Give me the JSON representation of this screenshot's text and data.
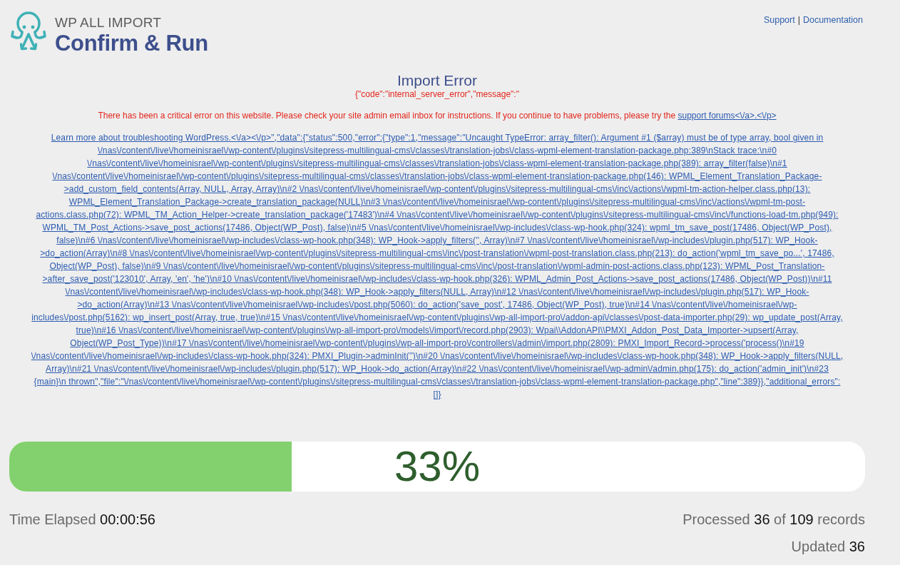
{
  "header": {
    "brand": "WP ALL IMPORT",
    "title": "Confirm & Run",
    "links": [
      {
        "label": "Support"
      },
      {
        "label": "Documentation"
      }
    ],
    "separator": "|"
  },
  "error": {
    "title": "Import Error",
    "code_line": "{\"code\":\"internal_server_error\",\"message\":\"",
    "message": {
      "text": "There has been a critical error on this website. Please check your site admin email inbox for instructions. If you continue to have problems, please try the",
      "link": "support forums<\\/a>.<\\/p>"
    },
    "details_link": "Learn more about troubleshooting WordPress.<\\/a><\\/p>\",\"data\":{\"status\":500,\"error\":{\"type\":1,\"message\":\"Uncaught TypeError: array_filter(): Argument #1 ($array) must be of type array, bool given in \\/nas\\/content\\/live\\/homeinisrael\\/wp-content\\/plugins\\/sitepress-multilingual-cms\\/classes\\/translation-jobs\\/class-wpml-element-translation-package.php:389\\nStack trace:\\n#0 \\/nas\\/content\\/live\\/homeinisrael\\/wp-content\\/plugins\\/sitepress-multilingual-cms\\/classes\\/translation-jobs\\/class-wpml-element-translation-package.php(389): array_filter(false)\\n#1 \\/nas\\/content\\/live\\/homeinisrael\\/wp-content\\/plugins\\/sitepress-multilingual-cms\\/classes\\/translation-jobs\\/class-wpml-element-translation-package.php(146): WPML_Element_Translation_Package->add_custom_field_contents(Array, NULL, Array, Array)\\n#2 \\/nas\\/content\\/live\\/homeinisrael\\/wp-content\\/plugins\\/sitepress-multilingual-cms\\/inc\\/actions\\/wpml-tm-action-helper.class.php(13): WPML_Element_Translation_Package->create_translation_package(NULL)\\n#3 \\/nas\\/content\\/live\\/homeinisrael\\/wp-content\\/plugins\\/sitepress-multilingual-cms\\/inc\\/actions\\/wpml-tm-post-actions.class.php(72): WPML_TM_Action_Helper->create_translation_package('17483')\\n#4 \\/nas\\/content\\/live\\/homeinisrael\\/wp-content\\/plugins\\/sitepress-multilingual-cms\\/inc\\/functions-load-tm.php(949): WPML_TM_Post_Actions->save_post_actions(17486, Object(WP_Post), false)\\n#5 \\/nas\\/content\\/live\\/homeinisrael\\/wp-includes\\/class-wp-hook.php(324): wpml_tm_save_post(17486, Object(WP_Post), false)\\n#6 \\/nas\\/content\\/live\\/homeinisrael\\/wp-includes\\/class-wp-hook.php(348): WP_Hook->apply_filters('', Array)\\n#7 \\/nas\\/content\\/live\\/homeinisrael\\/wp-includes\\/plugin.php(517): WP_Hook->do_action(Array)\\n#8 \\/nas\\/content\\/live\\/homeinisrael\\/wp-content\\/plugins\\/sitepress-multilingual-cms\\/inc\\/post-translation\\/wpml-post-translation.class.php(213): do_action('wpml_tm_save_po...', 17486, Object(WP_Post), false)\\n#9 \\/nas\\/content\\/live\\/homeinisrael\\/wp-content\\/plugins\\/sitepress-multilingual-cms\\/inc\\/post-translation\\/wpml-admin-post-actions.class.php(123): WPML_Post_Translation->after_save_post('123010', Array, 'en', 'he')\\n#10 \\/nas\\/content\\/live\\/homeinisrael\\/wp-includes\\/class-wp-hook.php(326): WPML_Admin_Post_Actions->save_post_actions(17486, Object(WP_Post))\\n#11 \\/nas\\/content\\/live\\/homeinisrael\\/wp-includes\\/class-wp-hook.php(348): WP_Hook->apply_filters(NULL, Array)\\n#12 \\/nas\\/content\\/live\\/homeinisrael\\/wp-includes\\/plugin.php(517): WP_Hook->do_action(Array)\\n#13 \\/nas\\/content\\/live\\/homeinisrael\\/wp-includes\\/post.php(5060): do_action('save_post', 17486, Object(WP_Post), true)\\n#14 \\/nas\\/content\\/live\\/homeinisrael\\/wp-includes\\/post.php(5162): wp_insert_post(Array, true, true)\\n#15 \\/nas\\/content\\/live\\/homeinisrael\\/wp-content\\/plugins\\/wp-all-import-pro\\/addon-api\\/classes\\/post-data-importer.php(29): wp_update_post(Array, true)\\n#16 \\/nas\\/content\\/live\\/homeinisrael\\/wp-content\\/plugins\\/wp-all-import-pro\\/models\\/import\\/record.php(2903): Wpai\\\\AddonAPI\\\\PMXI_Addon_Post_Data_Importer->upsert(Array, Object(WP_Post_Type))\\n#17 \\/nas\\/content\\/live\\/homeinisrael\\/wp-content\\/plugins\\/wp-all-import-pro\\/controllers\\/admin\\/import.php(2809): PMXI_Import_Record->process('process()\\n#19 \\/nas\\/content\\/live\\/homeinisrael\\/wp-includes\\/class-wp-hook.php(324): PMXI_Plugin->adminInit('')\\n#20 \\/nas\\/content\\/live\\/homeinisrael\\/wp-includes\\/class-wp-hook.php(348): WP_Hook->apply_filters(NULL, Array)\\n#21 \\/nas\\/content\\/live\\/homeinisrael\\/wp-includes\\/plugin.php(517): WP_Hook->do_action(Array)\\n#22 \\/nas\\/content\\/live\\/homeinisrael\\/wp-admin\\/admin.php(175): do_action('admin_init')\\n#23 {main}\\n thrown\",\"file\":\"\\/nas\\/content\\/live\\/homeinisrael\\/wp-content\\/plugins\\/sitepress-multilingual-cms\\/classes\\/translation-jobs\\/class-wpml-element-translation-package.php\",\"line\":389}},\"additional_errors\":[]}"
  },
  "progress": {
    "level": 0.33,
    "label": "33%"
  },
  "stats": {
    "time_elapsed": {
      "label": "Time Elapsed",
      "value": "00:00:56"
    },
    "processed": {
      "parts": [
        {
          "text": "Processed",
          "kind": "label"
        },
        {
          "text": "36",
          "kind": "value"
        },
        {
          "text": "of",
          "kind": "label"
        },
        {
          "text": "109",
          "kind": "value"
        },
        {
          "text": "records",
          "kind": "label"
        }
      ]
    },
    "updated": {
      "label": "Updated",
      "value": "36"
    }
  }
}
